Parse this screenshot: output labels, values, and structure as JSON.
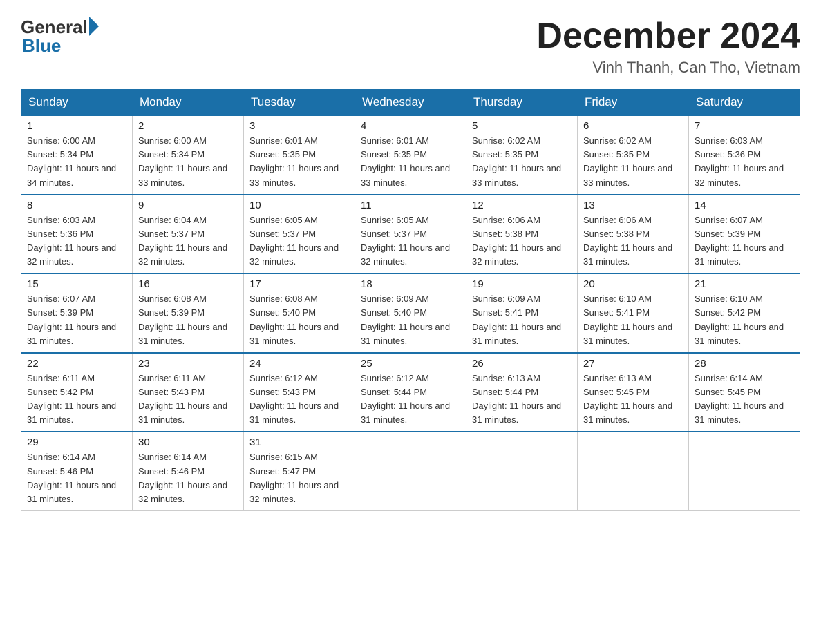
{
  "logo": {
    "general": "General",
    "blue": "Blue"
  },
  "header": {
    "month_year": "December 2024",
    "location": "Vinh Thanh, Can Tho, Vietnam"
  },
  "days_of_week": [
    "Sunday",
    "Monday",
    "Tuesday",
    "Wednesday",
    "Thursday",
    "Friday",
    "Saturday"
  ],
  "weeks": [
    [
      {
        "day": "1",
        "sunrise": "6:00 AM",
        "sunset": "5:34 PM",
        "daylight": "11 hours and 34 minutes."
      },
      {
        "day": "2",
        "sunrise": "6:00 AM",
        "sunset": "5:34 PM",
        "daylight": "11 hours and 33 minutes."
      },
      {
        "day": "3",
        "sunrise": "6:01 AM",
        "sunset": "5:35 PM",
        "daylight": "11 hours and 33 minutes."
      },
      {
        "day": "4",
        "sunrise": "6:01 AM",
        "sunset": "5:35 PM",
        "daylight": "11 hours and 33 minutes."
      },
      {
        "day": "5",
        "sunrise": "6:02 AM",
        "sunset": "5:35 PM",
        "daylight": "11 hours and 33 minutes."
      },
      {
        "day": "6",
        "sunrise": "6:02 AM",
        "sunset": "5:35 PM",
        "daylight": "11 hours and 33 minutes."
      },
      {
        "day": "7",
        "sunrise": "6:03 AM",
        "sunset": "5:36 PM",
        "daylight": "11 hours and 32 minutes."
      }
    ],
    [
      {
        "day": "8",
        "sunrise": "6:03 AM",
        "sunset": "5:36 PM",
        "daylight": "11 hours and 32 minutes."
      },
      {
        "day": "9",
        "sunrise": "6:04 AM",
        "sunset": "5:37 PM",
        "daylight": "11 hours and 32 minutes."
      },
      {
        "day": "10",
        "sunrise": "6:05 AM",
        "sunset": "5:37 PM",
        "daylight": "11 hours and 32 minutes."
      },
      {
        "day": "11",
        "sunrise": "6:05 AM",
        "sunset": "5:37 PM",
        "daylight": "11 hours and 32 minutes."
      },
      {
        "day": "12",
        "sunrise": "6:06 AM",
        "sunset": "5:38 PM",
        "daylight": "11 hours and 32 minutes."
      },
      {
        "day": "13",
        "sunrise": "6:06 AM",
        "sunset": "5:38 PM",
        "daylight": "11 hours and 31 minutes."
      },
      {
        "day": "14",
        "sunrise": "6:07 AM",
        "sunset": "5:39 PM",
        "daylight": "11 hours and 31 minutes."
      }
    ],
    [
      {
        "day": "15",
        "sunrise": "6:07 AM",
        "sunset": "5:39 PM",
        "daylight": "11 hours and 31 minutes."
      },
      {
        "day": "16",
        "sunrise": "6:08 AM",
        "sunset": "5:39 PM",
        "daylight": "11 hours and 31 minutes."
      },
      {
        "day": "17",
        "sunrise": "6:08 AM",
        "sunset": "5:40 PM",
        "daylight": "11 hours and 31 minutes."
      },
      {
        "day": "18",
        "sunrise": "6:09 AM",
        "sunset": "5:40 PM",
        "daylight": "11 hours and 31 minutes."
      },
      {
        "day": "19",
        "sunrise": "6:09 AM",
        "sunset": "5:41 PM",
        "daylight": "11 hours and 31 minutes."
      },
      {
        "day": "20",
        "sunrise": "6:10 AM",
        "sunset": "5:41 PM",
        "daylight": "11 hours and 31 minutes."
      },
      {
        "day": "21",
        "sunrise": "6:10 AM",
        "sunset": "5:42 PM",
        "daylight": "11 hours and 31 minutes."
      }
    ],
    [
      {
        "day": "22",
        "sunrise": "6:11 AM",
        "sunset": "5:42 PM",
        "daylight": "11 hours and 31 minutes."
      },
      {
        "day": "23",
        "sunrise": "6:11 AM",
        "sunset": "5:43 PM",
        "daylight": "11 hours and 31 minutes."
      },
      {
        "day": "24",
        "sunrise": "6:12 AM",
        "sunset": "5:43 PM",
        "daylight": "11 hours and 31 minutes."
      },
      {
        "day": "25",
        "sunrise": "6:12 AM",
        "sunset": "5:44 PM",
        "daylight": "11 hours and 31 minutes."
      },
      {
        "day": "26",
        "sunrise": "6:13 AM",
        "sunset": "5:44 PM",
        "daylight": "11 hours and 31 minutes."
      },
      {
        "day": "27",
        "sunrise": "6:13 AM",
        "sunset": "5:45 PM",
        "daylight": "11 hours and 31 minutes."
      },
      {
        "day": "28",
        "sunrise": "6:14 AM",
        "sunset": "5:45 PM",
        "daylight": "11 hours and 31 minutes."
      }
    ],
    [
      {
        "day": "29",
        "sunrise": "6:14 AM",
        "sunset": "5:46 PM",
        "daylight": "11 hours and 31 minutes."
      },
      {
        "day": "30",
        "sunrise": "6:14 AM",
        "sunset": "5:46 PM",
        "daylight": "11 hours and 32 minutes."
      },
      {
        "day": "31",
        "sunrise": "6:15 AM",
        "sunset": "5:47 PM",
        "daylight": "11 hours and 32 minutes."
      },
      null,
      null,
      null,
      null
    ]
  ]
}
